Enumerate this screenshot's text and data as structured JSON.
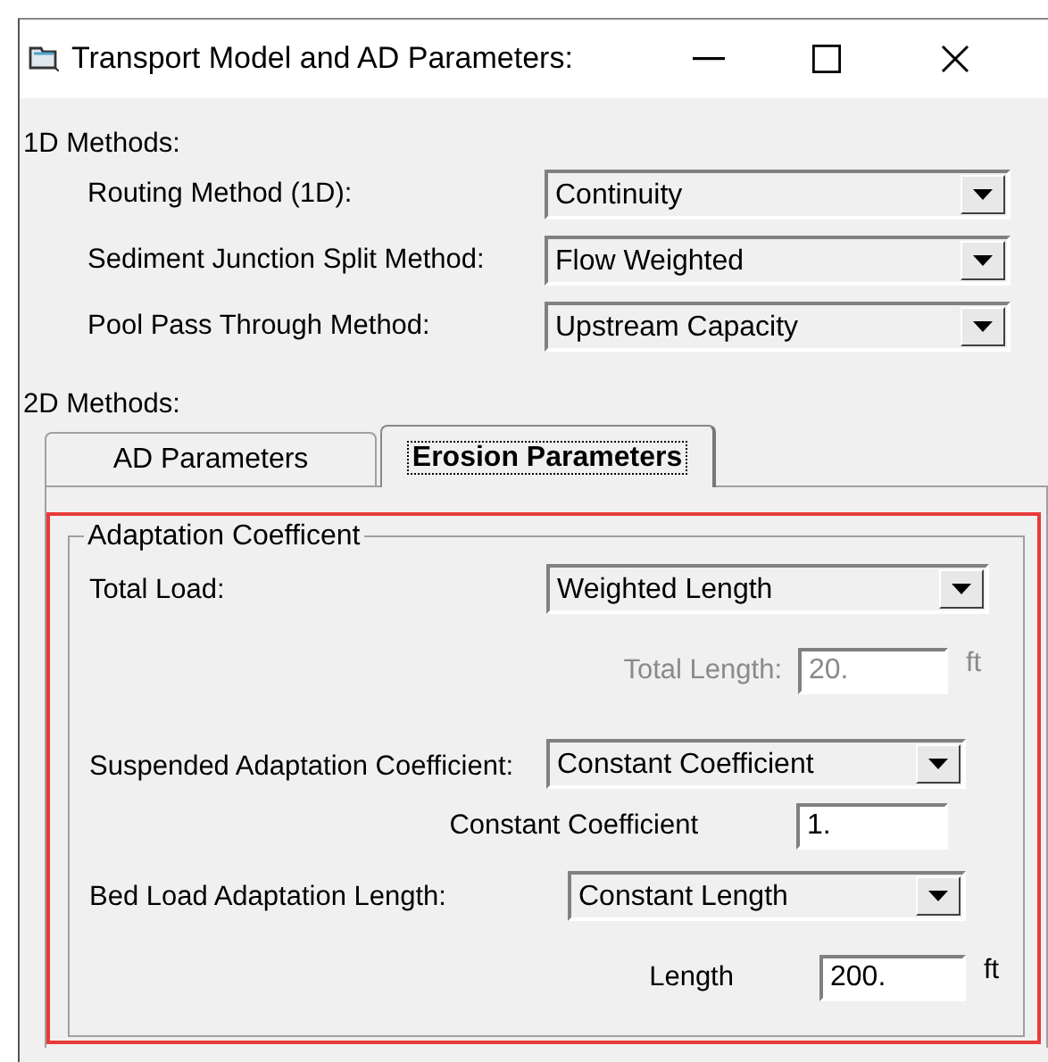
{
  "window": {
    "title": "Transport Model and AD Parameters:"
  },
  "methods_1d": {
    "label": "1D Methods:",
    "rows": [
      {
        "label": "Routing Method (1D):",
        "value": "Continuity"
      },
      {
        "label": "Sediment Junction Split Method:",
        "value": "Flow Weighted"
      },
      {
        "label": "Pool Pass Through Method:",
        "value": "Upstream Capacity"
      }
    ]
  },
  "methods_2d": {
    "label": "2D Methods:"
  },
  "tabs": [
    {
      "label": "AD Parameters",
      "selected": false
    },
    {
      "label": "Erosion Parameters",
      "selected": true
    }
  ],
  "group": {
    "legend": "Adaptation Coefficent",
    "highlighted": true,
    "items": [
      {
        "kind": "select",
        "label": "Total Load:",
        "value": "Weighted Length"
      },
      {
        "kind": "number",
        "label": "Total Length:",
        "value": "20.",
        "unit": "ft",
        "disabled": true
      },
      {
        "kind": "select",
        "label": "Suspended Adaptation Coefficient:",
        "value": "Constant Coefficient"
      },
      {
        "kind": "number",
        "label": "Constant Coefficient",
        "value": "1.",
        "disabled": false
      },
      {
        "kind": "select",
        "label": "Bed Load Adaptation Length:",
        "value": "Constant Length"
      },
      {
        "kind": "number",
        "label": "Length",
        "value": "200.",
        "unit": "ft",
        "disabled": false
      }
    ]
  }
}
